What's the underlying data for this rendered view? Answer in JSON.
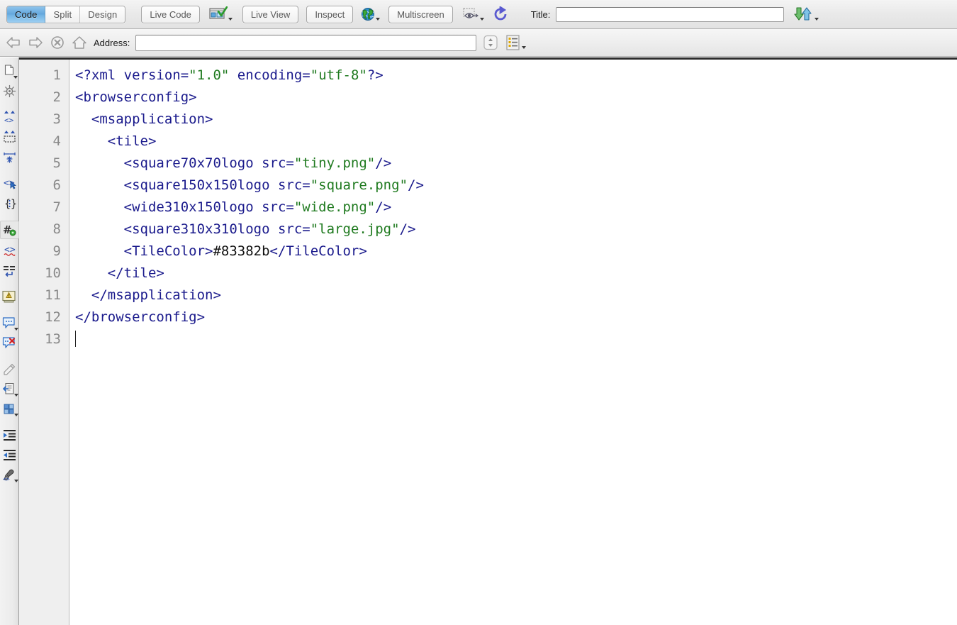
{
  "toolbar": {
    "view_modes": [
      {
        "label": "Code",
        "active": true
      },
      {
        "label": "Split",
        "active": false
      },
      {
        "label": "Design",
        "active": false
      }
    ],
    "live_code_label": "Live Code",
    "browser_preview_icon": "browser-check-icon",
    "live_view_label": "Live View",
    "inspect_label": "Inspect",
    "globe_icon": "globe-icon",
    "multiscreen_label": "Multiscreen",
    "visual_aids_icon": "eye-visual-aids-icon",
    "refresh_icon": "refresh-icon",
    "title_label": "Title:",
    "title_value": "",
    "title_placeholder": "",
    "file_transfer_icon": "upload-download-arrows-icon"
  },
  "addressbar": {
    "back_icon": "back-arrow-icon",
    "forward_icon": "forward-arrow-icon",
    "stop_icon": "stop-x-icon",
    "home_icon": "home-icon",
    "address_label": "Address:",
    "address_value": "",
    "address_placeholder": "",
    "stepper_icon": "up-down-stepper-icon",
    "list_view_icon": "list-view-icon"
  },
  "coding_sidebar": {
    "items": [
      {
        "icon": "open-documents-icon",
        "has_caret": true
      },
      {
        "icon": "validation-wheel-icon",
        "has_caret": false
      },
      {
        "icon": "collapse-full-tag-icon",
        "has_caret": false
      },
      {
        "icon": "collapse-selection-icon",
        "has_caret": false
      },
      {
        "icon": "expand-all-icon",
        "has_caret": false
      },
      {
        "icon": "select-parent-tag-icon",
        "has_caret": false
      },
      {
        "icon": "balance-braces-icon",
        "has_caret": false
      },
      {
        "icon": "line-numbers-icon",
        "has_caret": false,
        "boxed": true
      },
      {
        "icon": "highlight-invalid-code-icon",
        "has_caret": false
      },
      {
        "icon": "word-wrap-icon",
        "has_caret": false
      },
      {
        "icon": "syntax-error-alerts-icon",
        "has_caret": false
      },
      {
        "icon": "apply-comment-icon",
        "has_caret": true
      },
      {
        "icon": "remove-comment-icon",
        "has_caret": false
      },
      {
        "icon": "wrap-tag-icon",
        "has_caret": false
      },
      {
        "icon": "recent-snippets-icon",
        "has_caret": true
      },
      {
        "icon": "move-css-rules-icon",
        "has_caret": true
      },
      {
        "icon": "indent-code-icon",
        "has_caret": false
      },
      {
        "icon": "outdent-code-icon",
        "has_caret": false
      },
      {
        "icon": "format-source-code-icon",
        "has_caret": true
      }
    ]
  },
  "editor": {
    "language": "xml",
    "line_numbers": [
      1,
      2,
      3,
      4,
      5,
      6,
      7,
      8,
      9,
      10,
      11,
      12,
      13
    ],
    "cursor_line": 13,
    "lines": [
      {
        "n": 1,
        "text": "<?xml version=\"1.0\" encoding=\"utf-8\"?>"
      },
      {
        "n": 2,
        "text": "<browserconfig>"
      },
      {
        "n": 3,
        "text": "  <msapplication>"
      },
      {
        "n": 4,
        "text": "    <tile>"
      },
      {
        "n": 5,
        "text": "      <square70x70logo src=\"tiny.png\"/>"
      },
      {
        "n": 6,
        "text": "      <square150x150logo src=\"square.png\"/>"
      },
      {
        "n": 7,
        "text": "      <wide310x150logo src=\"wide.png\"/>"
      },
      {
        "n": 8,
        "text": "      <square310x310logo src=\"large.jpg\"/>"
      },
      {
        "n": 9,
        "text": "      <TileColor>#83382b</TileColor>"
      },
      {
        "n": 10,
        "text": "    </tile>"
      },
      {
        "n": 11,
        "text": "  </msapplication>"
      },
      {
        "n": 12,
        "text": "</browserconfig>"
      },
      {
        "n": 13,
        "text": ""
      }
    ],
    "tile_color_value": "#83382b"
  },
  "colors": {
    "tag": "#1a1a8c",
    "attribute_value": "#1f7a1f",
    "text_content": "#111111",
    "gutter_bg": "#efefef",
    "line_number": "#8a8a8a",
    "active_tab": "#63a7dd"
  }
}
